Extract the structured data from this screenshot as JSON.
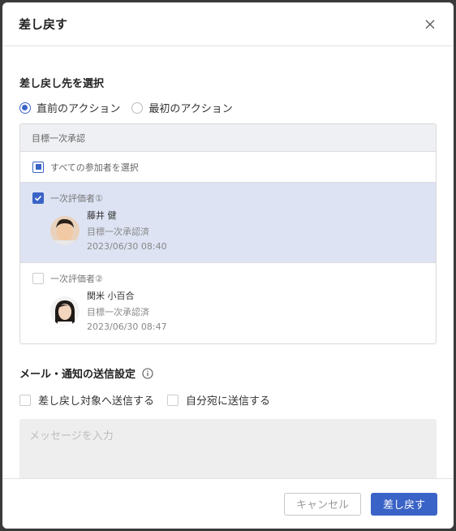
{
  "dialog": {
    "title": "差し戻す",
    "close_icon": "close-icon"
  },
  "target_section": {
    "title": "差し戻し先を選択",
    "options": [
      {
        "label": "直前のアクション",
        "selected": true
      },
      {
        "label": "最初のアクション",
        "selected": false
      }
    ],
    "step_name": "目標一次承認",
    "select_all_label": "すべての参加者を選択",
    "evaluators": [
      {
        "role": "一次評価者①",
        "name": "藤井 健",
        "status": "目標一次承認済",
        "date": "2023/06/30 08:40",
        "checked": true
      },
      {
        "role": "一次評価者②",
        "name": "関米 小百合",
        "status": "目標一次承認済",
        "date": "2023/06/30 08:47",
        "checked": false
      }
    ]
  },
  "notification_section": {
    "title": "メール・通知の送信設定",
    "info_icon": "info-icon",
    "options": [
      {
        "label": "差し戻し対象へ送信する",
        "checked": false
      },
      {
        "label": "自分宛に送信する",
        "checked": false
      }
    ],
    "message_placeholder": "メッセージを入力"
  },
  "footer": {
    "cancel_label": "キャンセル",
    "submit_label": "差し戻す"
  },
  "colors": {
    "accent": "#3a63c7",
    "selected_row": "#dde3f3"
  }
}
